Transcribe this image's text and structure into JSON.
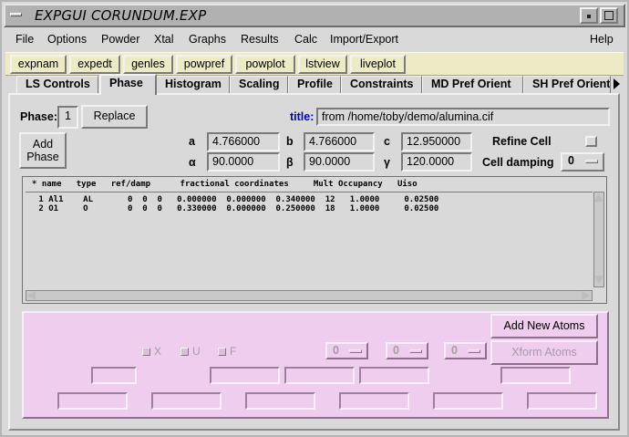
{
  "window": {
    "title": "EXPGUI CORUNDUM.EXP"
  },
  "menubar": {
    "items": [
      "File",
      "Options",
      "Powder",
      "Xtal",
      "Graphs",
      "Results",
      "Calc",
      "Import/Export"
    ],
    "help": "Help"
  },
  "toolbar": {
    "buttons": [
      "expnam",
      "expedt",
      "genles",
      "powpref",
      "powplot",
      "lstview",
      "liveplot"
    ]
  },
  "tabs": {
    "items": [
      "LS Controls",
      "Phase",
      "Histogram",
      "Scaling",
      "Profile",
      "Constraints",
      "MD Pref Orient",
      "SH Pref Orient"
    ],
    "active": "Phase"
  },
  "phase": {
    "label": "Phase:",
    "number": "1",
    "replace_label": "Replace",
    "add_phase_label_1": "Add",
    "add_phase_label_2": "Phase",
    "title_label": "title:",
    "title_value": "from /home/toby/demo/alumina.cif",
    "title_color": "#0000cc"
  },
  "cell": {
    "a_label": "a",
    "a": "4.766000",
    "b_label": "b",
    "b": "4.766000",
    "c_label": "c",
    "c": "12.950000",
    "alpha_label": "α",
    "alpha": "90.0000",
    "beta_label": "β",
    "beta": "90.0000",
    "gamma_label": "γ",
    "gamma": "120.0000",
    "refine_label": "Refine Cell",
    "damping_label": "Cell damping",
    "damping_value": "0"
  },
  "atoms": {
    "header": "* name   type   ref/damp      fractional coordinates     Mult Occupancy   Uiso",
    "rows": [
      " 1 Al1    AL       0  0  0   0.000000  0.000000  0.340000  12   1.0000     0.02500",
      " 2 O1     O        0  0  0   0.330000  0.000000  0.250000  18   1.0000     0.02500"
    ]
  },
  "editor": {
    "add_atoms_label": "Add New Atoms",
    "xform_label": "Xform Atoms",
    "x_label": "X",
    "u_label": "U",
    "f_label": "F",
    "damp_values": [
      "0",
      "0",
      "0"
    ],
    "background": "#efcdef"
  }
}
